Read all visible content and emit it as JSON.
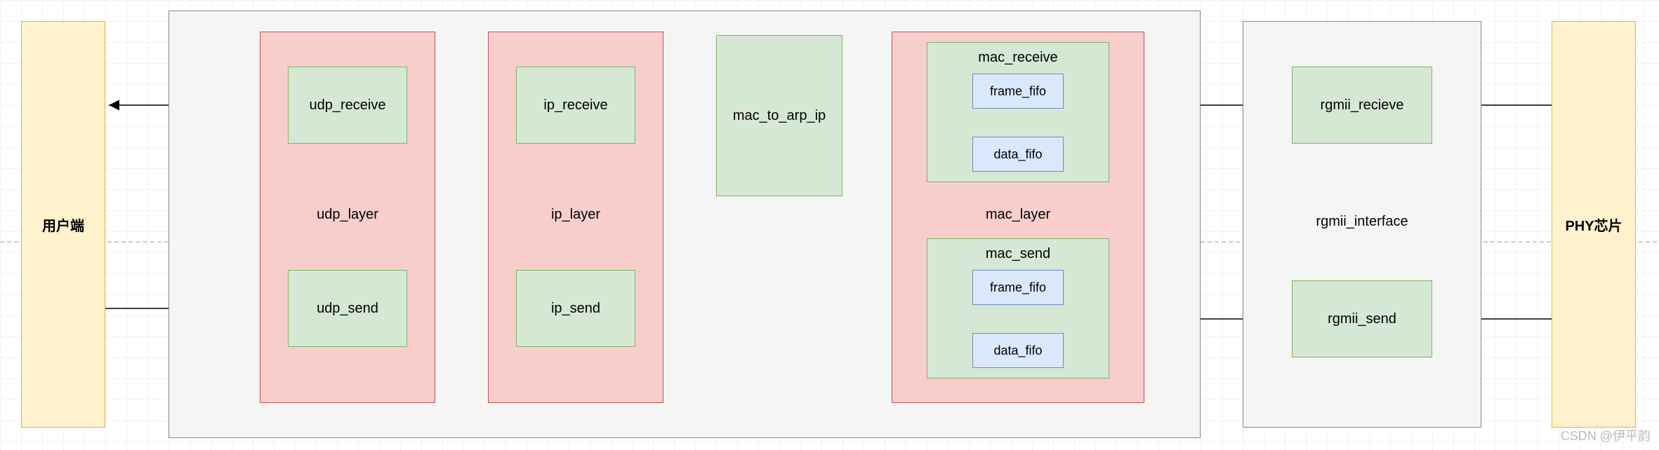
{
  "endpoints": {
    "left_label": "用户端",
    "right_label": "PHY芯片"
  },
  "main_container": {
    "udp_layer": {
      "title": "udp_layer",
      "receive": "udp_receive",
      "send": "udp_send"
    },
    "ip_layer": {
      "title": "ip_layer",
      "receive": "ip_receive",
      "send": "ip_send"
    },
    "mac_to_arp_ip": {
      "label": "mac_to_arp_ip"
    },
    "mac_layer": {
      "title": "mac_layer",
      "receive": {
        "title": "mac_receive",
        "frame_fifo": "frame_fifo",
        "data_fifo": "data_fifo"
      },
      "send": {
        "title": "mac_send",
        "frame_fifo": "frame_fifo",
        "data_fifo": "data_fifo"
      }
    }
  },
  "rgmii_interface": {
    "title": "rgmii_interface",
    "receive": "rgmii_recieve",
    "send": "rgmii_send"
  },
  "watermark": "CSDN @伊平韵"
}
